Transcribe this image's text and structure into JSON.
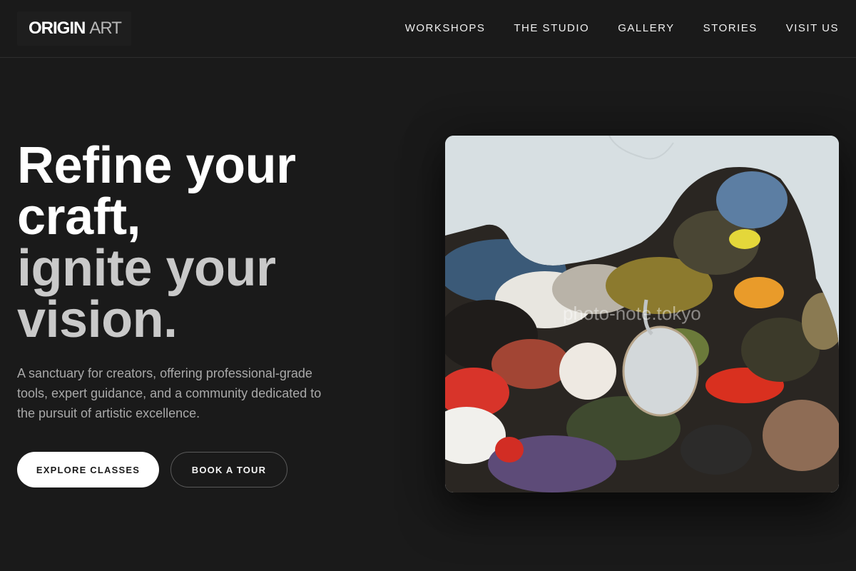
{
  "brand": {
    "name_part1": "ORIGIN",
    "name_part2": "ART"
  },
  "nav": {
    "items": [
      {
        "label": "WORKSHOPS"
      },
      {
        "label": "THE STUDIO"
      },
      {
        "label": "GALLERY"
      },
      {
        "label": "STORIES"
      },
      {
        "label": "VISIT US"
      }
    ]
  },
  "hero": {
    "title_line1": "Refine your craft,",
    "title_line2": "ignite your vision.",
    "description": "A sanctuary for creators, offering professional-grade tools, expert guidance, and a community dedicated to the pursuit of artistic excellence.",
    "primary_button": "EXPLORE CLASSES",
    "secondary_button": "BOOK A TOUR",
    "image_watermark": "photo-note.tokyo"
  },
  "colors": {
    "background": "#1a1a1a",
    "text_primary": "#ffffff",
    "text_muted": "#c9c9c9",
    "text_body": "#a9a9a9"
  }
}
